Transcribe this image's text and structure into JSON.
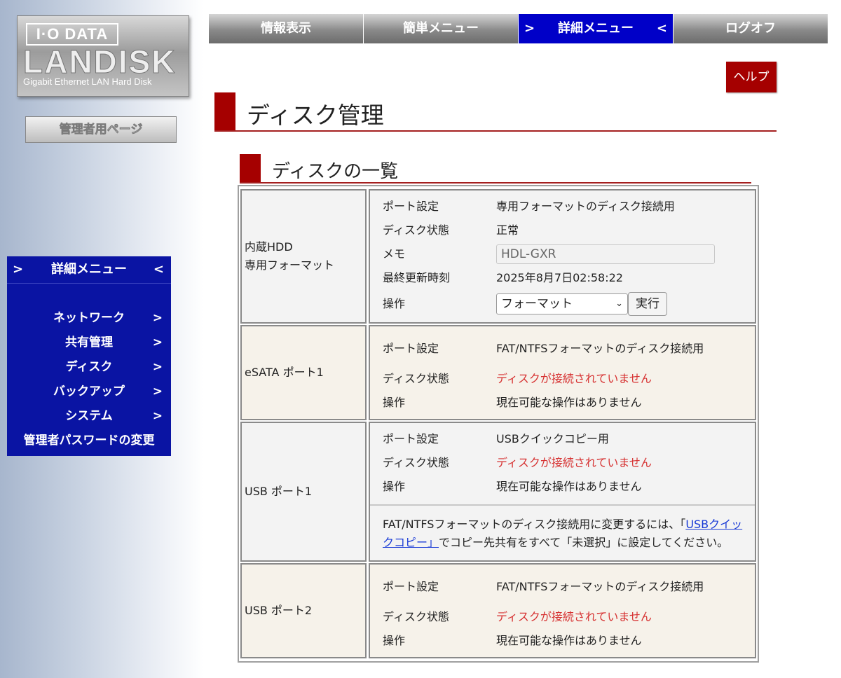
{
  "logo": {
    "brand": "I·O DATA",
    "product": "LANDISK",
    "subtitle": "Gigabit Ethernet LAN Hard Disk"
  },
  "admin_page_label": "管理者用ページ",
  "sidebar": {
    "header": "詳細メニュー",
    "items": [
      {
        "label": "ネットワーク"
      },
      {
        "label": "共有管理"
      },
      {
        "label": "ディスク"
      },
      {
        "label": "バックアップ"
      },
      {
        "label": "システム"
      }
    ],
    "password_change": "管理者パスワードの変更"
  },
  "topnav": {
    "tabs": [
      {
        "label": "情報表示"
      },
      {
        "label": "簡単メニュー"
      },
      {
        "label": "詳細メニュー"
      },
      {
        "label": "ログオフ"
      }
    ]
  },
  "help_label": "ヘルプ",
  "page_title": "ディスク管理",
  "section_title": "ディスクの一覧",
  "disks": {
    "internal": {
      "name_line1": "内蔵HDD",
      "name_line2": "専用フォーマット",
      "port_label": "ポート設定",
      "port_value": "専用フォーマットのディスク接続用",
      "status_label": "ディスク状態",
      "status_value": "正常",
      "memo_label": "メモ",
      "memo_value": "HDL-GXR",
      "updated_label": "最終更新時刻",
      "updated_value": "2025年8月7日02:58:22",
      "op_label": "操作",
      "op_selected": "フォーマット",
      "exec_label": "実行"
    },
    "esata1": {
      "name": "eSATA ポート1",
      "port_label": "ポート設定",
      "port_value": "FAT/NTFSフォーマットのディスク接続用",
      "status_label": "ディスク状態",
      "status_value": "ディスクが接続されていません",
      "op_label": "操作",
      "op_value": "現在可能な操作はありません"
    },
    "usb1": {
      "name": "USB ポート1",
      "port_label": "ポート設定",
      "port_value": "USBクイックコピー用",
      "status_label": "ディスク状態",
      "status_value": "ディスクが接続されていません",
      "op_label": "操作",
      "op_value": "現在可能な操作はありません",
      "note_before": "FAT/NTFSフォーマットのディスク接続用に変更するには、「",
      "note_link": "USBクイックコピー」",
      "note_after": "でコピー先共有をすべて「未選択」に設定してください。"
    },
    "usb2": {
      "name": "USB ポート2",
      "port_label": "ポート設定",
      "port_value": "FAT/NTFSフォーマットのディスク接続用",
      "status_label": "ディスク状態",
      "status_value": "ディスクが接続されていません",
      "op_label": "操作",
      "op_value": "現在可能な操作はありません"
    }
  }
}
